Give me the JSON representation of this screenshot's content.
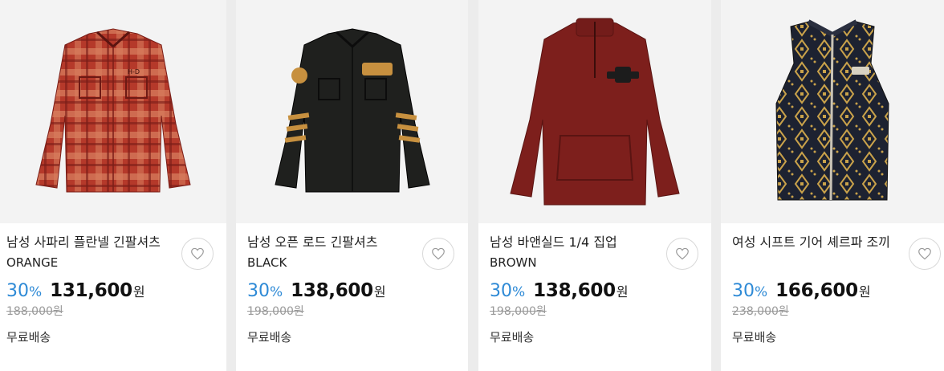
{
  "products": [
    {
      "name": "남성 사파리 플란넬 긴팔셔츠",
      "color": "ORANGE",
      "discount": "30",
      "discount_unit": "%",
      "price": "131,600",
      "currency": "원",
      "original_price": "188,000원",
      "shipping": "무료배송",
      "wishlist_icon": "heart-icon"
    },
    {
      "name": "남성 오픈 로드 긴팔셔츠",
      "color": "BLACK",
      "discount": "30",
      "discount_unit": "%",
      "price": "138,600",
      "currency": "원",
      "original_price": "198,000원",
      "shipping": "무료배송",
      "wishlist_icon": "heart-icon"
    },
    {
      "name": "남성 바앤실드 1/4 집업",
      "color": "BROWN",
      "discount": "30",
      "discount_unit": "%",
      "price": "138,600",
      "currency": "원",
      "original_price": "198,000원",
      "shipping": "무료배송",
      "wishlist_icon": "heart-icon"
    },
    {
      "name": "여성 시프트 기어 셰르파 조끼",
      "color": "",
      "discount": "30",
      "discount_unit": "%",
      "price": "166,600",
      "currency": "원",
      "original_price": "238,000원",
      "shipping": "무료배송",
      "wishlist_icon": "heart-icon"
    }
  ],
  "colors": {
    "discount": "#2e8ad6",
    "page_bg": "#ececec",
    "image_bg": "#f3f3f3"
  }
}
